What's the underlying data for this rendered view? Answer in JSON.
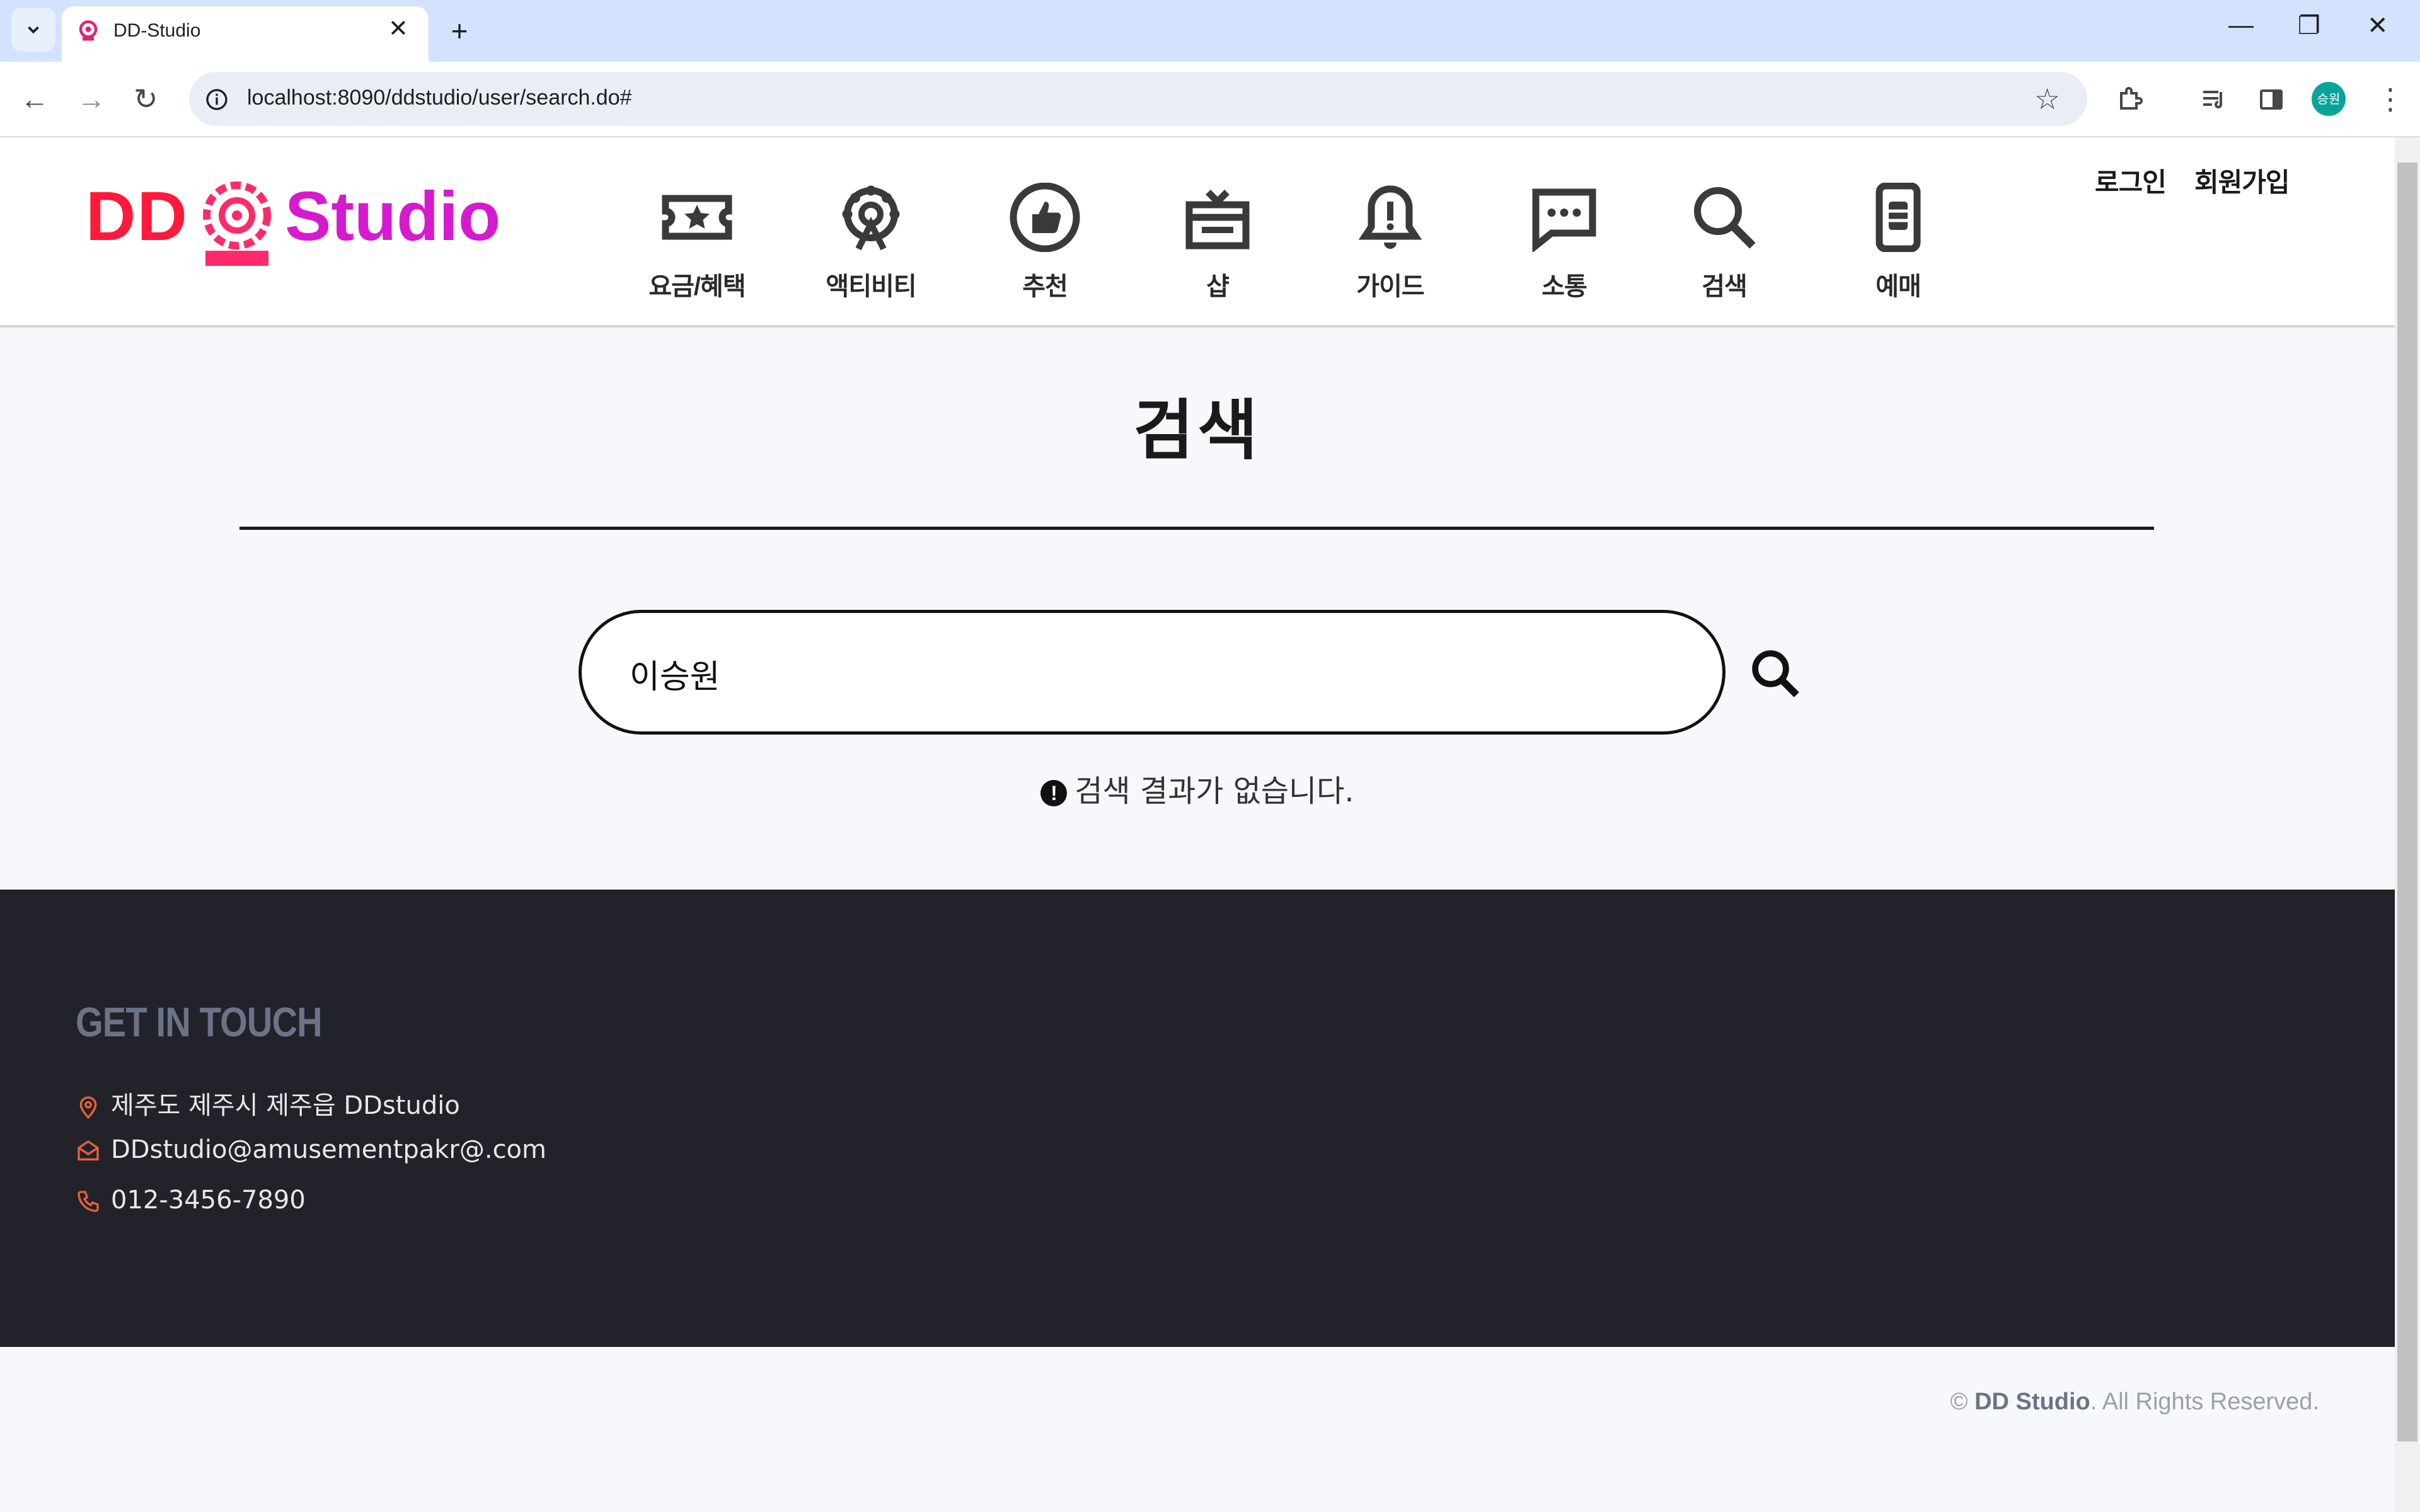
{
  "browser": {
    "tab_title": "DD-Studio",
    "url": "localhost:8090/ddstudio/user/search.do#",
    "profile_initials": "승원"
  },
  "header": {
    "logo_left": "DD",
    "logo_right": "Studio",
    "nav": [
      {
        "label": "요금/혜택",
        "icon": "ticket-star-icon"
      },
      {
        "label": "액티비티",
        "icon": "ferris-wheel-icon"
      },
      {
        "label": "추천",
        "icon": "thumbs-up-icon"
      },
      {
        "label": "샵",
        "icon": "gift-box-icon"
      },
      {
        "label": "가이드",
        "icon": "bell-alert-icon"
      },
      {
        "label": "소통",
        "icon": "chat-bubble-icon"
      },
      {
        "label": "검색",
        "icon": "search-icon"
      },
      {
        "label": "예매",
        "icon": "mobile-ticket-icon"
      }
    ],
    "login": "로그인",
    "signup": "회원가입"
  },
  "main": {
    "title": "검색",
    "search_value": "이승원",
    "no_result": "검색 결과가 없습니다."
  },
  "footer": {
    "title": "GET IN TOUCH",
    "address": "제주도 제주시 제주읍 DDstudio",
    "email": "DDstudio@amusementpakr@.com",
    "phone": "012-3456-7890",
    "copyright_symbol": "©",
    "copyright_brand": "DD Studio",
    "copyright_rest": ". All Rights Reserved."
  },
  "colors": {
    "logo_red": "#ff1a3c",
    "logo_magenta": "#d61ad0",
    "footer_bg": "#22232a",
    "footer_icon": "#e8623a"
  }
}
